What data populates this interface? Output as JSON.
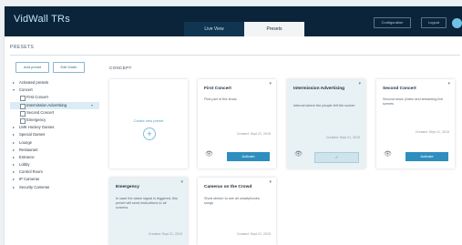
{
  "app": {
    "brand": "VidWall TRs"
  },
  "tabs": [
    {
      "label": "Live View"
    },
    {
      "label": "Presets"
    }
  ],
  "topbar": {
    "config_label": "Configuration",
    "logout_label": "Logout"
  },
  "page": {
    "presets_label": "PRESETS",
    "concept_label": "CONCEPT"
  },
  "sidebar": {
    "add_label": "Add preset",
    "edit_label": "Edit folder",
    "tree": [
      {
        "label": "Activated presets",
        "level": 0,
        "caret": "▸"
      },
      {
        "label": "Concert",
        "level": 0,
        "caret": "▾"
      },
      {
        "label": "First Concert",
        "level": 1
      },
      {
        "label": "Intermission Advertising",
        "level": 1,
        "selected": true
      },
      {
        "label": "Second Concert",
        "level": 1
      },
      {
        "label": "Emergency",
        "level": 1
      },
      {
        "label": "LMK Hockey Games",
        "level": 0,
        "caret": "▸"
      },
      {
        "label": "Special Games",
        "level": 0,
        "caret": "▸"
      },
      {
        "label": "Lounge",
        "level": 0,
        "caret": "▸"
      },
      {
        "label": "Restaurant",
        "level": 0,
        "caret": "▸"
      },
      {
        "label": "Entrance",
        "level": 0,
        "caret": "▸"
      },
      {
        "label": "Lobby",
        "level": 0,
        "caret": "▸"
      },
      {
        "label": "Control Room",
        "level": 0,
        "caret": "▸"
      },
      {
        "label": "IP Cameras",
        "level": 0,
        "caret": "▸"
      },
      {
        "label": "Security Cameras",
        "level": 0,
        "caret": "▸"
      }
    ]
  },
  "create_card": {
    "label": "Create new preset",
    "icon": "plus-icon"
  },
  "cards": [
    {
      "title": "First Concert",
      "desc": "First part of the show.",
      "date": "Created: Sept 21, 2015",
      "action": "Activate",
      "highlight": false
    },
    {
      "title": "Intermission Advertising",
      "desc": "Interval where the people left the screen",
      "date": "Created: Sept 21, 2015",
      "action": "✓",
      "highlight": true
    },
    {
      "title": "Second Concert",
      "desc": "Second show (video and streaming live scenes",
      "date": "Created: Sept 21, 2015",
      "action": "Activate",
      "highlight": false
    },
    {
      "title": "Emergency",
      "desc": "In case the alarm signal is triggered, this preset will send instructions to all screens.",
      "date": "Created: Sept 21, 2015",
      "action": "",
      "highlight": true
    },
    {
      "title": "Cameras on the Crowd",
      "desc": "Short stretch to see all smartphones songs",
      "date": "Created: Sept 21, 2015",
      "action": "",
      "highlight": false
    }
  ]
}
